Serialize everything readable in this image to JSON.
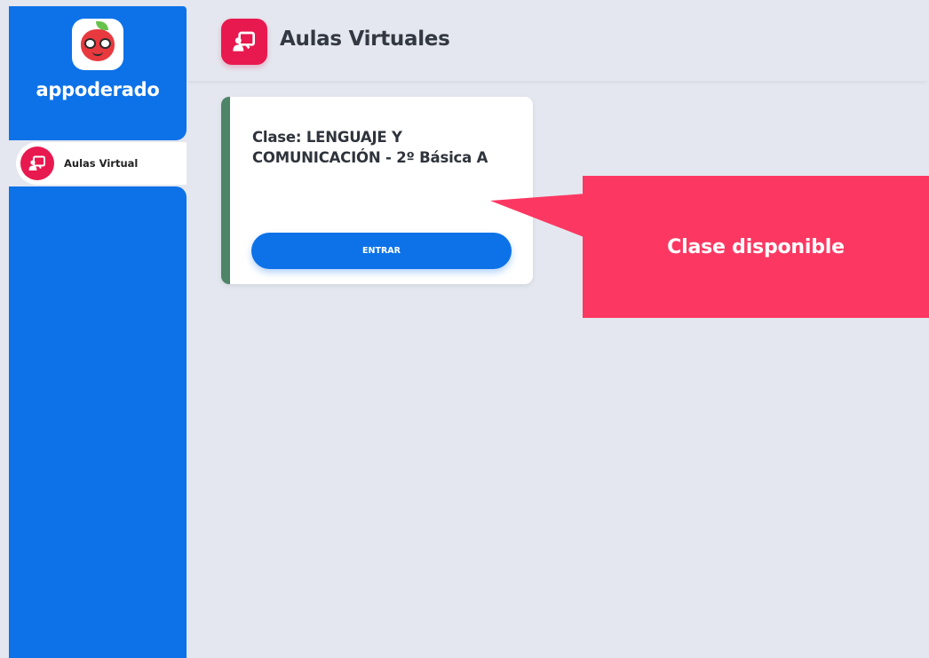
{
  "app": {
    "logo_text": "appoderado"
  },
  "sidebar": {
    "items": [
      {
        "label": "Aulas Virtual",
        "icon": "classroom-board-icon",
        "active": true
      }
    ]
  },
  "header": {
    "title": "Aulas Virtuales",
    "icon": "classroom-board-icon"
  },
  "classes": [
    {
      "title": "Clase: LENGUAJE Y COMUNICACIÓN - 2º Básica A",
      "button_label": "ENTRAR"
    }
  ],
  "callout": {
    "text": "Clase disponible"
  },
  "colors": {
    "primary_blue": "#0d72e8",
    "accent_red": "#e8194f",
    "callout_pink": "#fc3862",
    "card_accent_green": "#4e8468",
    "background": "#e4e7ef"
  }
}
